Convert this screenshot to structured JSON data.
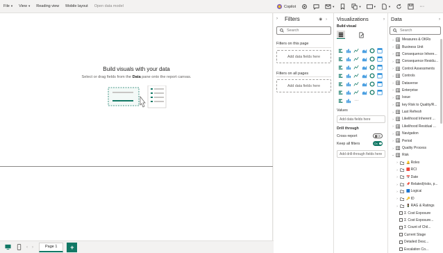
{
  "menu": {
    "items": [
      {
        "label": "File",
        "caret": true
      },
      {
        "label": "View",
        "caret": true
      },
      {
        "label": "Reading view",
        "caret": false
      },
      {
        "label": "Mobile layout",
        "caret": false
      },
      {
        "label": "Open data model",
        "caret": false,
        "disabled": true
      }
    ]
  },
  "toolbar": {
    "copilot": "Copilot"
  },
  "canvas": {
    "title": "Build visuals with your data",
    "subtitle_pre": "Select or drag fields from the ",
    "subtitle_bold": "Data",
    "subtitle_post": " pane onto the report canvas."
  },
  "bottom": {
    "page_tab": "Page 1",
    "add_page": "+"
  },
  "filters": {
    "title": "Filters",
    "search_placeholder": "Search",
    "on_this_page": "Filters on this page",
    "on_this_page_drop": "Add data fields here",
    "on_all_pages": "Filters on all pages",
    "on_all_pages_drop": "Add data fields here"
  },
  "visualizations": {
    "title": "Visualizations",
    "build_visual": "Build visual",
    "values_label": "Values",
    "values_drop": "Add data fields here",
    "drill_through": "Drill through",
    "cross_report": "Cross-report",
    "cross_report_state": "Off",
    "keep_all_filters": "Keep all filters",
    "keep_all_filters_state": "On",
    "drill_drop": "Add drill-through fields here"
  },
  "data_pane": {
    "title": "Data",
    "search_placeholder": "Search",
    "items": [
      {
        "label": "Measures & OKRs",
        "level": 0,
        "kind": "table"
      },
      {
        "label": "Business Unit",
        "level": 0,
        "kind": "table"
      },
      {
        "label": "Consequence Inhere...",
        "level": 0,
        "kind": "table"
      },
      {
        "label": "Consequence Residu...",
        "level": 0,
        "kind": "table"
      },
      {
        "label": "Control Assessments",
        "level": 0,
        "kind": "table"
      },
      {
        "label": "Controls",
        "level": 0,
        "kind": "table"
      },
      {
        "label": "Dataverse",
        "level": 0,
        "kind": "table"
      },
      {
        "label": "Enterprise",
        "level": 0,
        "kind": "table"
      },
      {
        "label": "Issue",
        "level": 0,
        "kind": "table"
      },
      {
        "label": "key Risk to Quality/R...",
        "level": 0,
        "kind": "table"
      },
      {
        "label": "Last Refresh",
        "level": 0,
        "kind": "table"
      },
      {
        "label": "Likelihood Inherent ...",
        "level": 0,
        "kind": "table"
      },
      {
        "label": "Likelihood Residual ...",
        "level": 0,
        "kind": "table"
      },
      {
        "label": "Navigation",
        "level": 0,
        "kind": "table"
      },
      {
        "label": "Period",
        "level": 0,
        "kind": "table"
      },
      {
        "label": "Quality Process",
        "level": 0,
        "kind": "table"
      },
      {
        "label": "Risk",
        "level": 0,
        "kind": "table",
        "expanded": true
      },
      {
        "label": "Roles",
        "level": 1,
        "kind": "folder",
        "emoji": "🔔"
      },
      {
        "label": "RCI",
        "level": 1,
        "kind": "folder",
        "emoji": "🟥"
      },
      {
        "label": "Date",
        "level": 1,
        "kind": "folder",
        "emoji": "📅"
      },
      {
        "label": "Related(risks, p...",
        "level": 1,
        "kind": "folder",
        "emoji": "📌"
      },
      {
        "label": "Logical",
        "level": 1,
        "kind": "folder",
        "emoji": "🟦"
      },
      {
        "label": "ID",
        "level": 1,
        "kind": "folder",
        "emoji": "🔑"
      },
      {
        "label": "RAG & Ratings",
        "level": 1,
        "kind": "folder",
        "emoji": "🚦"
      },
      {
        "label": "Cost Exposure",
        "level": 1,
        "kind": "measure"
      },
      {
        "label": "Cost Exposure...",
        "level": 1,
        "kind": "measure"
      },
      {
        "label": "Count of Chil...",
        "level": 1,
        "kind": "measure"
      },
      {
        "label": "Current Stage",
        "level": 1,
        "kind": "field"
      },
      {
        "label": "Detailed Desc...",
        "level": 1,
        "kind": "field"
      },
      {
        "label": "Escalation Co...",
        "level": 1,
        "kind": "field"
      }
    ]
  }
}
